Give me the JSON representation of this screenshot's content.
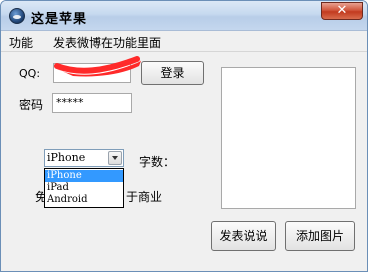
{
  "window": {
    "title": "这是苹果",
    "close_glyph": "✕"
  },
  "menu": {
    "items": [
      "功能",
      "发表微博在功能里面"
    ]
  },
  "form": {
    "qq_label": "QQ:",
    "qq_value": "",
    "login_label": "登录",
    "password_label": "密码",
    "password_value": "*****",
    "count_label": "字数：",
    "hidden_left": "免",
    "hidden_right": "于商业"
  },
  "combo": {
    "selected": "iPhone",
    "options": [
      "iPhone",
      "iPad",
      "Android"
    ],
    "highlighted_index": 0
  },
  "buttons": {
    "post": "发表说说",
    "add_image": "添加图片"
  },
  "colors": {
    "highlight": "#3399ff",
    "scribble": "#ff2a2a"
  }
}
